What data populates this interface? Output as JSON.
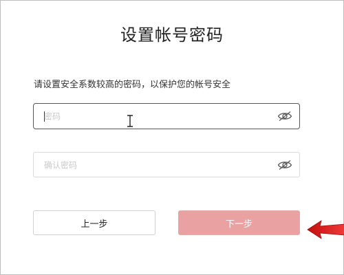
{
  "page": {
    "title": "设置帐号密码",
    "subtitle": "请设置安全系数较高的密码，以保护您的帐号安全"
  },
  "form": {
    "password": {
      "placeholder": "密码",
      "toggle_icon": "eye-off-icon"
    },
    "confirm_password": {
      "placeholder": "确认密码",
      "toggle_icon": "eye-off-icon"
    }
  },
  "buttons": {
    "prev_label": "上一步",
    "next_label": "下一步"
  },
  "colors": {
    "next_button_bg": "#e9a1a1",
    "focused_border": "#555555",
    "annotation_arrow": "#e01b1b"
  }
}
